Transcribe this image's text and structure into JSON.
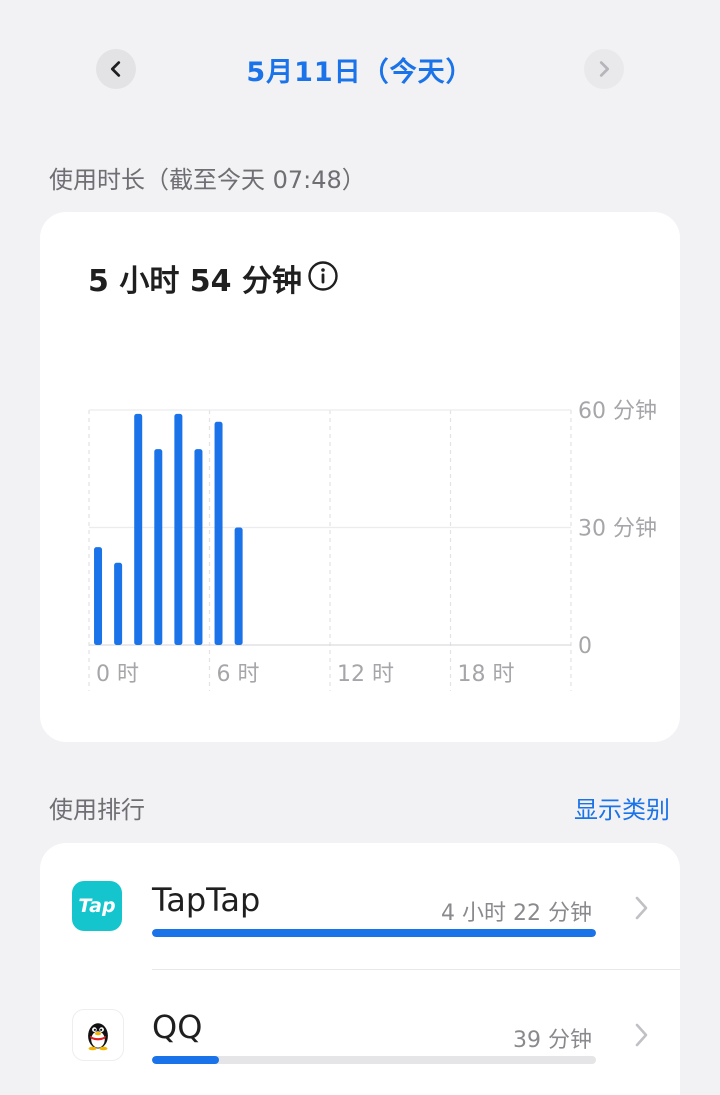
{
  "header": {
    "date_title": "5月11日（今天）"
  },
  "usage": {
    "section_label": "使用时长（截至今天 07:48）",
    "total": "5 小时 54 分钟"
  },
  "chart_data": {
    "type": "bar",
    "x_unit": "hour",
    "hours": [
      0,
      1,
      2,
      3,
      4,
      5,
      6,
      7
    ],
    "values": [
      25,
      21,
      59,
      50,
      59,
      50,
      57,
      30
    ],
    "ylim": [
      0,
      60
    ],
    "yticks": [
      0,
      30,
      60
    ],
    "ytick_labels": [
      "0",
      "30 分钟",
      "60 分钟"
    ],
    "xlim": [
      0,
      24
    ],
    "xticks": [
      0,
      6,
      12,
      18
    ],
    "xtick_labels": [
      "0 时",
      "6 时",
      "12 时",
      "18 时"
    ],
    "grid": true,
    "bar_color": "#1a73e8"
  },
  "ranking": {
    "section_label": "使用排行",
    "show_category_label": "显示类别",
    "apps": [
      {
        "name": "TapTap",
        "icon_label": "Tap",
        "duration": "4 小时 22 分钟",
        "share": 1.0,
        "icon": "taptap-icon"
      },
      {
        "name": "QQ",
        "duration": "39 分钟",
        "share": 0.15,
        "icon": "qq-penguin-icon"
      }
    ]
  },
  "colors": {
    "accent": "#1a73e8",
    "taptap": "#15c5ce",
    "track": "#e5e5e8"
  }
}
